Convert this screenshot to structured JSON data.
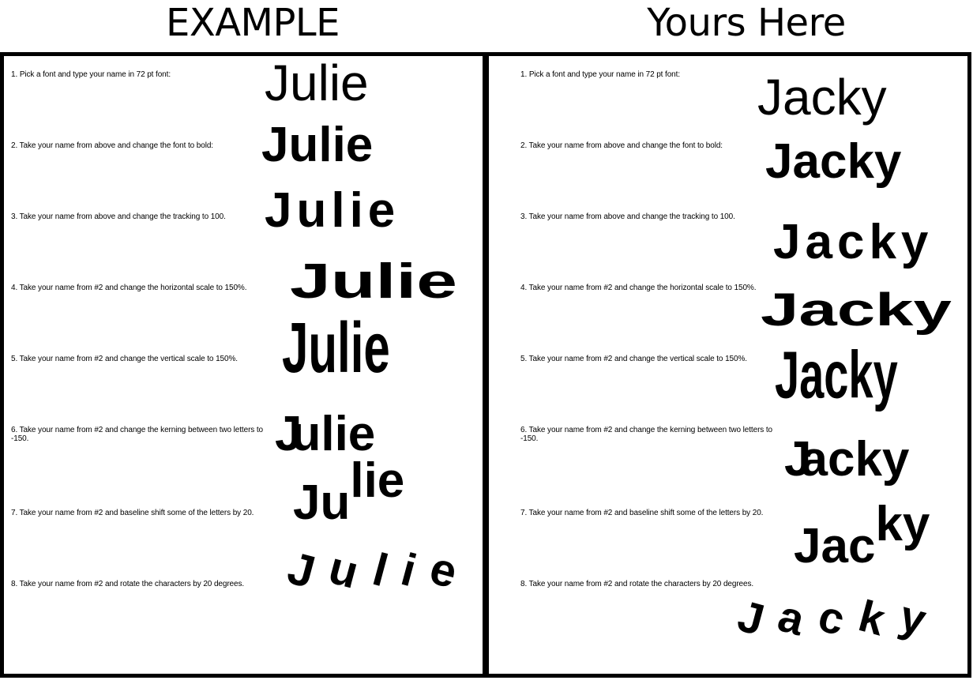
{
  "headings": {
    "left": "EXAMPLE",
    "right": "Yours Here"
  },
  "instructions": [
    "1. Pick a font and type your name in 72 pt font:",
    "2. Take your name from above and change the font to bold:",
    "3.  Take your name from above and change the tracking to 100.",
    "4. Take your name from #2 and change the horizontal scale to 150%.",
    "5. Take your name from #2 and change the vertical scale to 150%.",
    "6. Take your name from #2 and change the kerning between two letters to -150.",
    "7. Take your name from #2 and baseline shift some of the letters by 20.",
    "8. Take your name from #2 and rotate the characters by 20 degrees."
  ],
  "example": {
    "name": "Julie",
    "kern_a": "J",
    "kern_b": "ulie",
    "shift_a": "Ju",
    "shift_b": "lie",
    "rot": [
      "J",
      "u",
      "l",
      "i",
      "e"
    ]
  },
  "yours": {
    "name": "Jacky",
    "kern_a": "J",
    "kern_b": "acky",
    "shift_a": "Jac",
    "shift_b": "ky",
    "rot": [
      "J",
      "a",
      "c",
      "k",
      "y"
    ]
  }
}
